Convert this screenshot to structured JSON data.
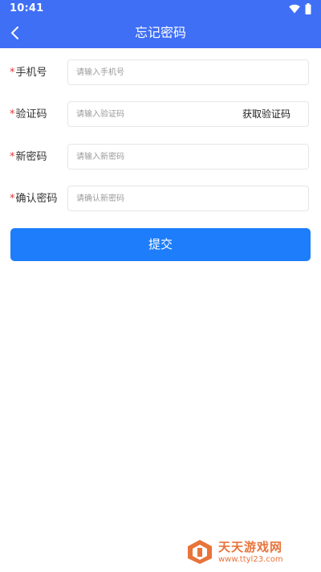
{
  "status_bar": {
    "time": "10:41",
    "wifi_icon": "wifi-icon",
    "battery_icon": "battery-icon"
  },
  "header": {
    "back_icon": "chevron-left-icon",
    "title": "忘记密码"
  },
  "form": {
    "phone": {
      "label": "手机号",
      "required_mark": "*",
      "placeholder": "请输入手机号",
      "value": ""
    },
    "code": {
      "label": "验证码",
      "required_mark": "*",
      "placeholder": "请输入验证码",
      "value": "",
      "action": "获取验证码"
    },
    "new_password": {
      "label": "新密码",
      "required_mark": "*",
      "placeholder": "请输入新密码",
      "value": ""
    },
    "confirm_password": {
      "label": "确认密码",
      "required_mark": "*",
      "placeholder": "请确认新密码",
      "value": ""
    },
    "submit": "提交"
  },
  "watermark": {
    "title": "天天游戏网",
    "url": "www.ttyl23.com"
  },
  "colors": {
    "header": "#3f6ff5",
    "submit": "#1d7dfa",
    "required": "#e53935",
    "watermark": "#e8743b"
  }
}
